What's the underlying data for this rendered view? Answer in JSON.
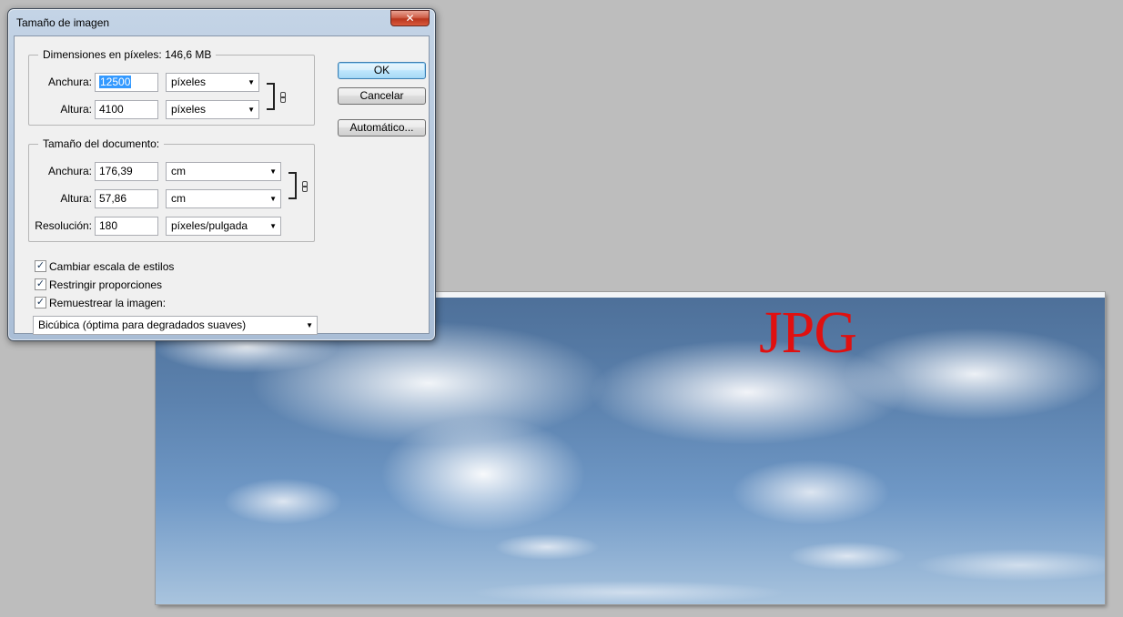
{
  "canvas": {
    "overlay_text": "JPG",
    "overlay_color": "#e01010"
  },
  "dialog": {
    "title": "Tamaño de imagen",
    "close_glyph": "✕",
    "pixel_dimensions": {
      "title": "Dimensiones en píxeles: 146,6 MB",
      "width_label": "Anchura:",
      "width_value": "12500",
      "width_unit": "píxeles",
      "height_label": "Altura:",
      "height_value": "4100",
      "height_unit": "píxeles"
    },
    "document_size": {
      "title": "Tamaño del documento:",
      "width_label": "Anchura:",
      "width_value": "176,39",
      "width_unit": "cm",
      "height_label": "Altura:",
      "height_value": "57,86",
      "height_unit": "cm",
      "resolution_label": "Resolución:",
      "resolution_value": "180",
      "resolution_unit": "píxeles/pulgada"
    },
    "buttons": {
      "ok": "OK",
      "cancel": "Cancelar",
      "auto": "Automático..."
    },
    "options": {
      "scale_styles": "Cambiar escala de estilos",
      "constrain": "Restringir proporciones",
      "resample": "Remuestrear la imagen:",
      "check_glyph": "✓"
    },
    "resample_method": "Bicúbica (óptima para degradados suaves)",
    "dropdown_glyph": "▼"
  },
  "colors": {
    "background": "#bdbdbd",
    "selection": "#3399ff",
    "close_button": "#c9472e"
  }
}
